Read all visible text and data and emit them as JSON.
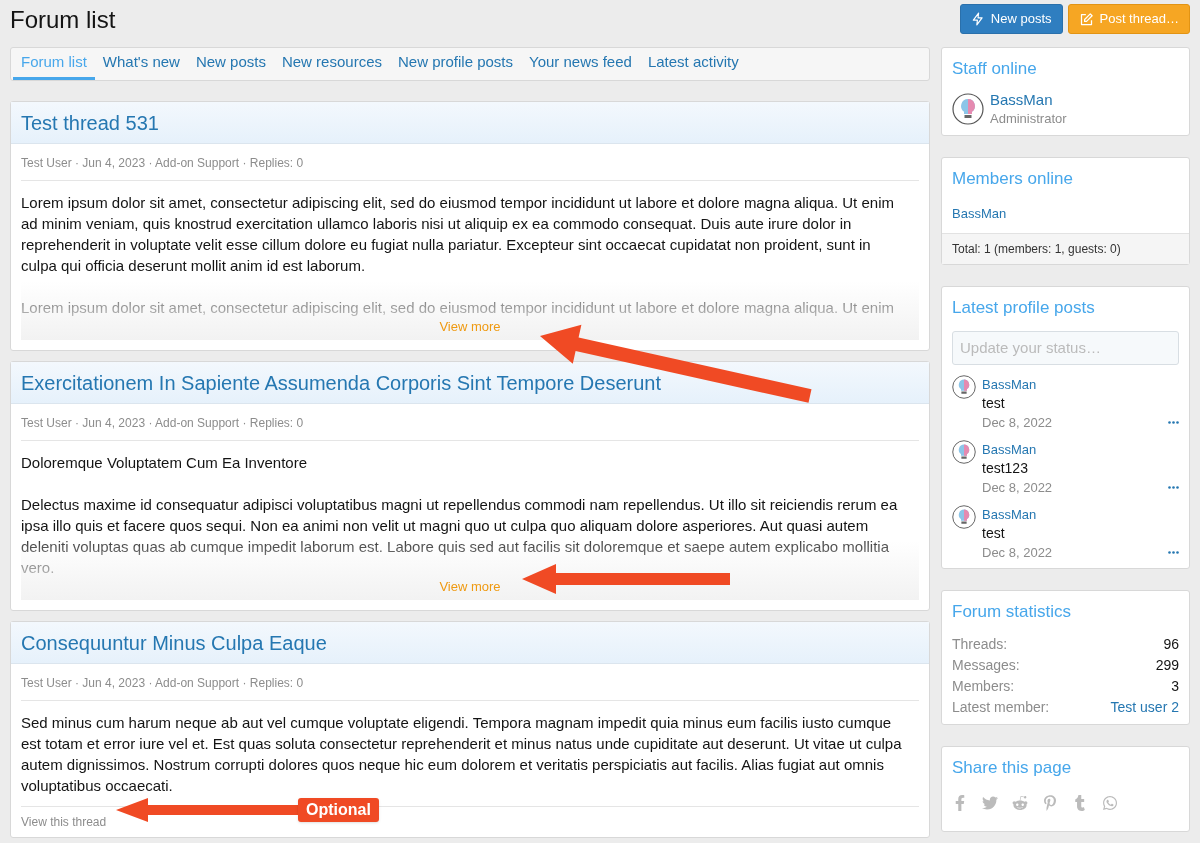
{
  "page_title": "Forum list",
  "header_buttons": [
    {
      "label": "New posts",
      "kind": "primary"
    },
    {
      "label": "Post thread…",
      "kind": "accent"
    }
  ],
  "tabs": [
    {
      "label": "Forum list",
      "selected": true
    },
    {
      "label": "What's new",
      "selected": false
    },
    {
      "label": "New posts",
      "selected": false
    },
    {
      "label": "New resources",
      "selected": false
    },
    {
      "label": "New profile posts",
      "selected": false
    },
    {
      "label": "Your news feed",
      "selected": false
    },
    {
      "label": "Latest activity",
      "selected": false
    }
  ],
  "posts": [
    {
      "title": "Test thread 531",
      "meta": "Test User · Jun 4, 2023 · Add-on Support · Replies: 0",
      "paragraphs": [
        "Lorem ipsum dolor sit amet, consectetur adipiscing elit, sed do eiusmod tempor incididunt ut labore et dolore magna aliqua. Ut enim ad minim veniam, quis knostrud exercitation ullamco laboris nisi ut aliquip ex ea commodo consequat. Duis aute irure dolor in reprehenderit in voluptate velit esse cillum dolore eu fugiat nulla pariatur. Excepteur sint occaecat cupidatat non proident, sunt in culpa qui officia deserunt mollit anim id est laborum.",
        "Lorem ipsum dolor sit amet, consectetur adipiscing elit, sed do eiusmod tempor incididunt ut labore et dolore magna aliqua. Ut enim"
      ],
      "truncated": true,
      "link": "View more"
    },
    {
      "title": "Exercitationem In Sapiente Assumenda Corporis Sint Tempore Deserunt",
      "meta": "Test User · Jun 4, 2023 · Add-on Support · Replies: 0",
      "paragraphs": [
        "Doloremque Voluptatem Cum Ea Inventore",
        "Delectus maxime id consequatur adipisci voluptatibus magni ut repellendus commodi nam repellendus. Ut illo sit reiciendis rerum ea ipsa illo quis et facere quos sequi. Non ea animi non velit ut magni quo ut culpa quo aliquam dolore asperiores. Aut quasi autem deleniti voluptas quas ab cumque impedit laborum est. Labore quis sed aut facilis sit doloremque et saepe autem explicabo mollitia vero."
      ],
      "truncated": true,
      "link": "View more"
    },
    {
      "title": "Consequuntur Minus Culpa Eaque",
      "meta": "Test User · Jun 4, 2023 · Add-on Support · Replies: 0",
      "paragraphs": [
        "Sed minus cum harum neque ab aut vel cumque voluptate eligendi. Tempora magnam impedit quia minus eum facilis iusto cumque est totam et error iure vel et. Est quas soluta consectetur reprehenderit et minus natus unde cupiditate aut deserunt. Ut vitae ut culpa autem dignissimos. Nostrum corrupti dolores quos neque hic eum dolorem et veritatis perspiciatis aut facilis. Alias fugiat aut omnis voluptatibus occaecati."
      ],
      "truncated": false,
      "link": "View this thread"
    }
  ],
  "annotation": {
    "label": "Optional"
  },
  "sidebar": {
    "staff_online": {
      "title": "Staff online",
      "members": [
        {
          "name": "BassMan",
          "role": "Administrator"
        }
      ]
    },
    "members_online": {
      "title": "Members online",
      "members": [
        "BassMan"
      ],
      "footer": "Total: 1 (members: 1, guests: 0)"
    },
    "latest_profile_posts": {
      "title": "Latest profile posts",
      "placeholder": "Update your status…",
      "posts": [
        {
          "author": "BassMan",
          "text": "test",
          "date": "Dec 8, 2022"
        },
        {
          "author": "BassMan",
          "text": "test123",
          "date": "Dec 8, 2022"
        },
        {
          "author": "BassMan",
          "text": "test",
          "date": "Dec 8, 2022"
        }
      ]
    },
    "forum_statistics": {
      "title": "Forum statistics",
      "rows": [
        {
          "label": "Threads:",
          "value": "96",
          "link": false
        },
        {
          "label": "Messages:",
          "value": "299",
          "link": false
        },
        {
          "label": "Members:",
          "value": "3",
          "link": false
        },
        {
          "label": "Latest member:",
          "value": "Test user 2",
          "link": true
        }
      ]
    },
    "share": {
      "title": "Share this page"
    }
  }
}
